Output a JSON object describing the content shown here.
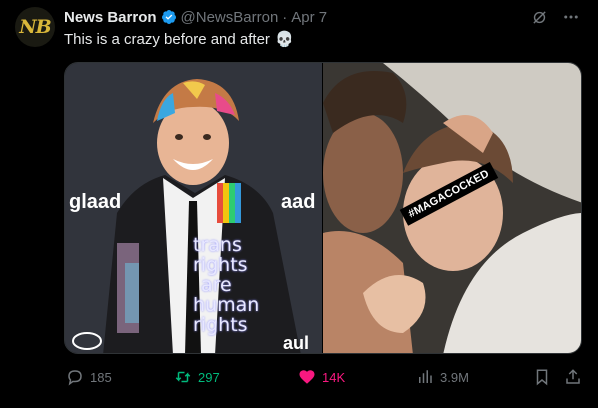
{
  "author": {
    "avatar_text": "NB",
    "name": "News Barron",
    "handle": "@NewsBarron",
    "separator": "·",
    "date": "Apr 7"
  },
  "tweet": {
    "text": "This is a crazy before and after",
    "emoji": "💀"
  },
  "media": {
    "left_backdrop": [
      "glaad",
      "aad",
      "aul"
    ],
    "jacket_text": [
      "trans",
      "rights",
      "are",
      "human",
      "rights"
    ],
    "badge": "#MAGACOCKED"
  },
  "actions": {
    "replies": "185",
    "retweets": "297",
    "likes": "14K",
    "views": "3.9M"
  },
  "colors": {
    "background": "#000000",
    "text": "#e7e9ea",
    "muted": "#71767b",
    "retweet": "#00ba7c",
    "like": "#f91880",
    "verified": "#1d9bf0"
  }
}
